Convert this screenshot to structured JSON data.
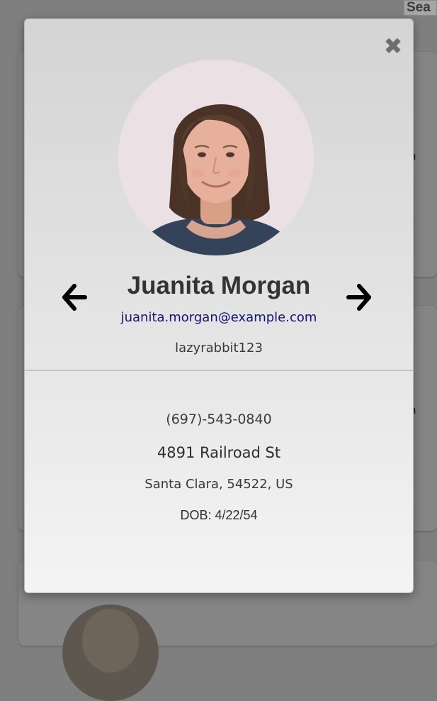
{
  "background": {
    "search_button_label": "Sea",
    "card_fragment_1": "n",
    "card_fragment_2": "n"
  },
  "modal": {
    "close_label": "✖",
    "photo_alt": "Juanita Morgan",
    "name": "Juanita Morgan",
    "email": "juanita.morgan@example.com",
    "username": "lazyrabbit123",
    "phone": "(697)-543-0840",
    "street": "4891 Railroad St",
    "city_line": "Santa Clara, 54522, US",
    "dob": "DOB: 4/22/54",
    "prev_icon": "arrow-left-icon",
    "next_icon": "arrow-right-icon"
  },
  "colors": {
    "overlay": "#7f7f7f",
    "email_link": "#12127a",
    "name_text": "#343434"
  }
}
